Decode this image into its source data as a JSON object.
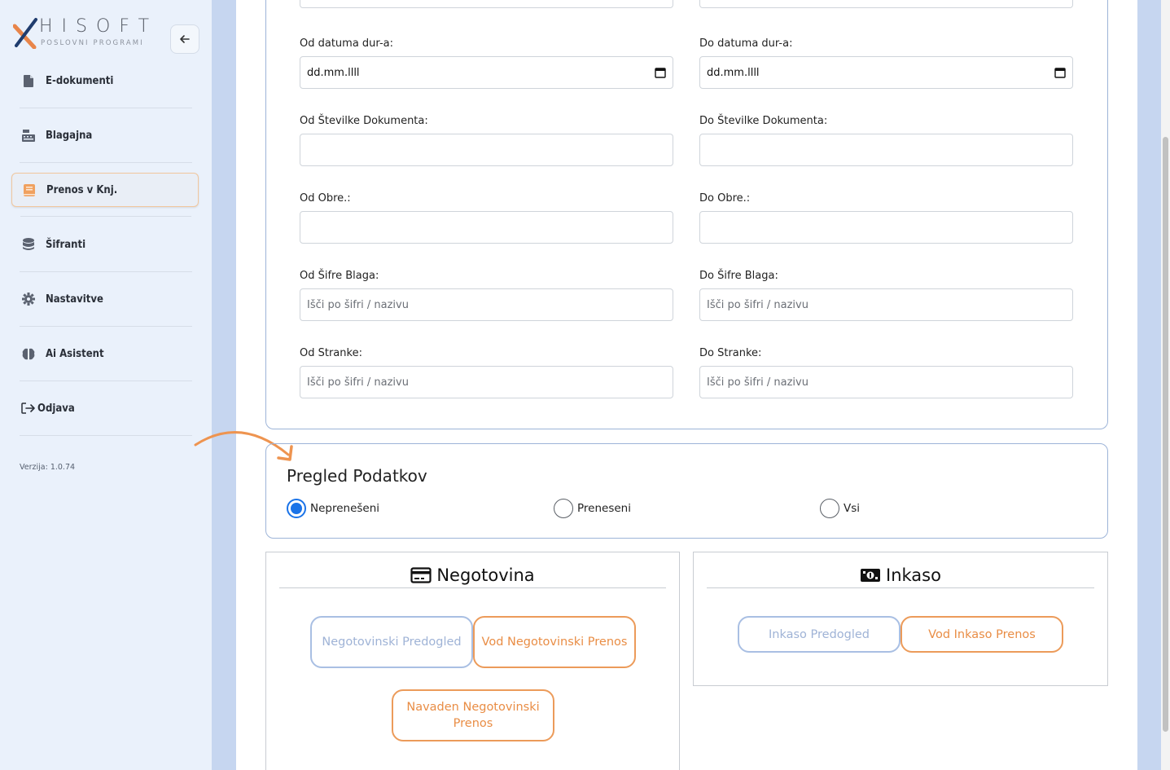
{
  "brand": {
    "name": "HISOFT",
    "subtitle": "POSLOVNI PROGRAMI"
  },
  "sidebar": {
    "items": [
      {
        "label": "E-dokumenti",
        "icon": "file-icon"
      },
      {
        "label": "Blagajna",
        "icon": "cash-register-icon"
      },
      {
        "label": "Prenos v Knj.",
        "icon": "book-icon",
        "active": true
      },
      {
        "label": "Šifranti",
        "icon": "database-icon"
      },
      {
        "label": "Nastavitve",
        "icon": "gear-icon"
      },
      {
        "label": "Ai Asistent",
        "icon": "brain-icon"
      },
      {
        "label": "Odjava",
        "icon": "logout-icon"
      }
    ],
    "version": "Verzija: 1.0.74"
  },
  "filters": {
    "od_datuma": {
      "label": "Od datuma dur-a:",
      "value": "dd.mm.llll"
    },
    "do_datuma": {
      "label": "Do datuma dur-a:",
      "value": "dd.mm.llll"
    },
    "od_stevilke": {
      "label": "Od Številke Dokumenta:",
      "value": ""
    },
    "do_stevilke": {
      "label": "Do Številke Dokumenta:",
      "value": ""
    },
    "od_obre": {
      "label": "Od Obre.:",
      "value": ""
    },
    "do_obre": {
      "label": "Do Obre.:",
      "value": ""
    },
    "od_sifre_blaga": {
      "label": "Od Šifre Blaga:",
      "placeholder": "Išči po šifri / nazivu"
    },
    "do_sifre_blaga": {
      "label": "Do Šifre Blaga:",
      "placeholder": "Išči po šifri / nazivu"
    },
    "od_stranke": {
      "label": "Od Stranke:",
      "placeholder": "Išči po šifri / nazivu"
    },
    "do_stranke": {
      "label": "Do Stranke:",
      "placeholder": "Išči po šifri / nazivu"
    }
  },
  "pregled": {
    "title": "Pregled Podatkov",
    "options": [
      {
        "label": "Neprenešeni",
        "checked": true
      },
      {
        "label": "Preneseni",
        "checked": false
      },
      {
        "label": "Vsi",
        "checked": false
      }
    ]
  },
  "negotovina": {
    "title": "Negotovina",
    "btn_predogled": "Negotovinski Predogled",
    "btn_vod": "Vod Negotovinski Prenos",
    "btn_navaden": "Navaden Negotovinski Prenos"
  },
  "inkaso": {
    "title": "Inkaso",
    "btn_predogled": "Inkaso Predogled",
    "btn_vod": "Vod Inkaso Prenos"
  },
  "colors": {
    "accent": "#ec9b5a",
    "primary": "#1a73e8",
    "border": "#9db4d8"
  }
}
